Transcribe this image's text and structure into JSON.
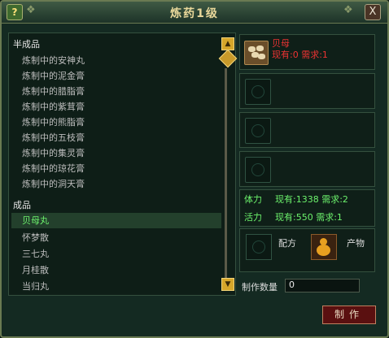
{
  "window": {
    "title": "炼药1级",
    "help_label": "?",
    "close_label": "X"
  },
  "recipe_list": {
    "categories": [
      {
        "label": "半成品",
        "items": [
          "炼制中的安神丸",
          "炼制中的泥金膏",
          "炼制中的腊脂膏",
          "炼制中的紫茸膏",
          "炼制中的熊脂膏",
          "炼制中的五枝膏",
          "炼制中的集灵膏",
          "炼制中的琼花膏",
          "炼制中的洞天膏"
        ]
      },
      {
        "label": "成品",
        "items": [
          "贝母丸",
          "怀梦散",
          "三七丸",
          "月桂散",
          "当归丸"
        ]
      }
    ],
    "selected_item": "贝母丸"
  },
  "materials": [
    {
      "name": "贝母",
      "requirement": "现有:0 需求:1",
      "icon": "herb-bag-icon"
    }
  ],
  "stats": {
    "stamina_label": "体力",
    "stamina_value": "现有:1338 需求:2",
    "vitality_label": "活力",
    "vitality_value": "现有:550 需求:1"
  },
  "output": {
    "recipe_label": "配方",
    "product_label": "产物",
    "product_icon": "gourd-icon"
  },
  "quantity": {
    "label": "制作数量",
    "value": "0"
  },
  "make_button": "制作",
  "colors": {
    "selected_text": "#6cf26c",
    "missing_material": "#ee3333",
    "stat_text": "#6cf26c"
  }
}
